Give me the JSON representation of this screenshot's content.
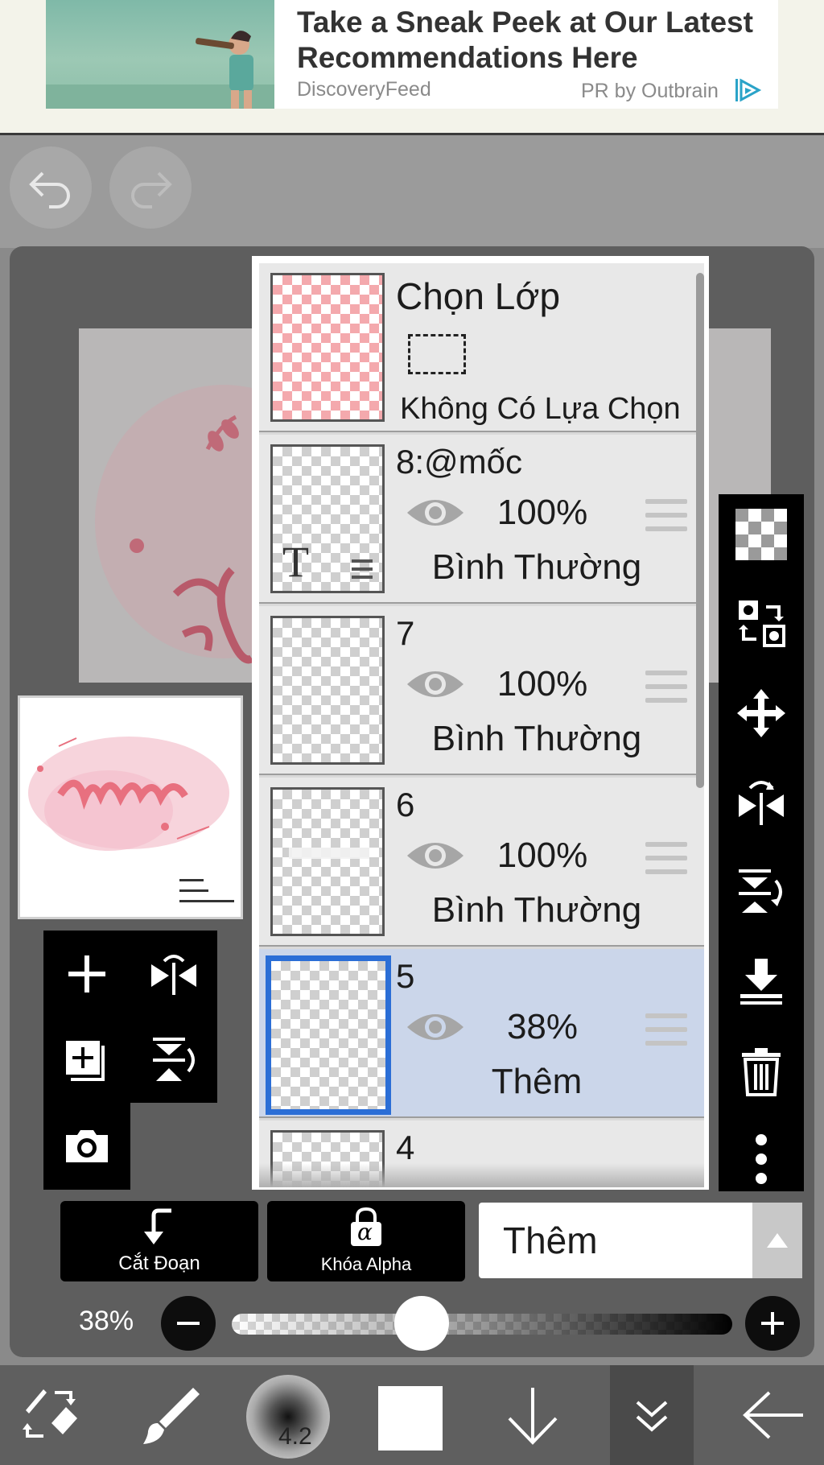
{
  "ad": {
    "title": "Take a Sneak Peek at Our Latest Recommendations Here",
    "source": "DiscoveryFeed",
    "provider": "PR by Outbrain"
  },
  "top_controls": {
    "undo_icon": "undo-icon",
    "redo_icon": "redo-icon"
  },
  "selection_layer": {
    "title": "Chọn Lớp",
    "status": "Không Có Lựa Chọn"
  },
  "layers": [
    {
      "name": "8:@mốc",
      "opacity": "100%",
      "blend": "Bình Thường",
      "selected": false
    },
    {
      "name": "7",
      "opacity": "100%",
      "blend": "Bình Thường",
      "selected": false
    },
    {
      "name": "6",
      "opacity": "100%",
      "blend": "Bình Thường",
      "selected": false
    },
    {
      "name": "5",
      "opacity": "38%",
      "blend": "Thêm",
      "selected": true
    },
    {
      "name": "4",
      "opacity": "",
      "blend": "",
      "selected": false
    }
  ],
  "layer_thumb_text_marker": "T",
  "bottom_actions": {
    "clip_label": "Cắt Đoạn",
    "alpha_lock_label": "Khóa Alpha",
    "alpha_lock_symbol": "α",
    "blend_mode": "Thêm"
  },
  "opacity": {
    "label": "38%",
    "value_fraction": 0.38
  },
  "brush": {
    "size": "4.2"
  },
  "colors": {
    "selected_layer_bg": "#cbd6ea",
    "selection_border": "#2b6ed6",
    "toolbar_bg": "#000000",
    "brush_color": "#ffffff"
  }
}
